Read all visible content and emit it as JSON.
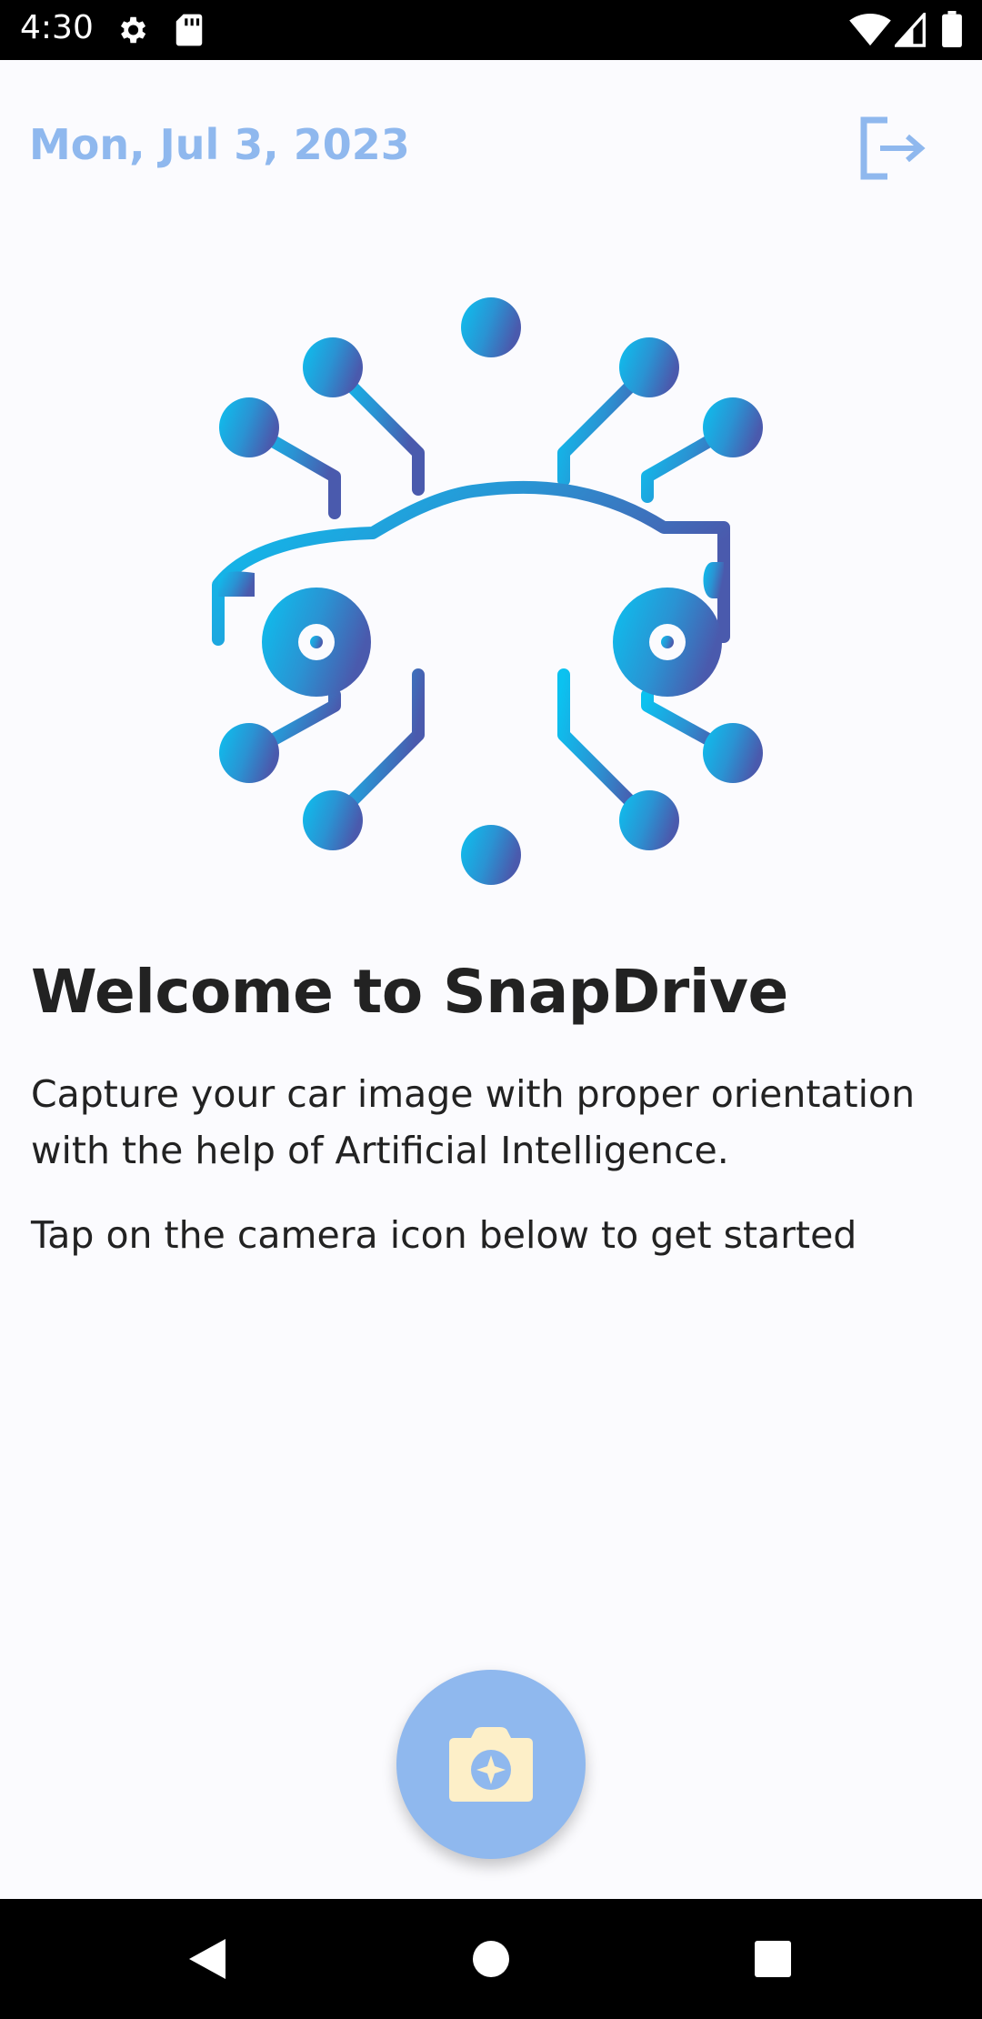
{
  "status_bar": {
    "time": "4:30",
    "icons": [
      "gear-icon",
      "sd-card-icon",
      "wifi-icon",
      "signal-icon",
      "battery-icon"
    ]
  },
  "header": {
    "date": "Mon, Jul 3, 2023",
    "logout_icon": "logout-icon"
  },
  "hero": {
    "icon": "ai-car-circuit-logo",
    "gradient_start": "#0BC2F0",
    "gradient_end": "#4A5AAD"
  },
  "welcome": {
    "title": "Welcome to SnapDrive",
    "description": "Capture your car image with proper orientation with the help of Artificial Intelligence.",
    "hint": "Tap on the camera icon below to get started"
  },
  "fab": {
    "icon": "camera-icon",
    "color": "#8FB8EE",
    "icon_color": "#FDEFC8"
  },
  "nav_bar": {
    "buttons": [
      "back-icon",
      "home-icon",
      "recents-icon"
    ]
  },
  "colors": {
    "accent": "#8FB8EE",
    "text": "#222222",
    "background": "#FBFBFE"
  }
}
